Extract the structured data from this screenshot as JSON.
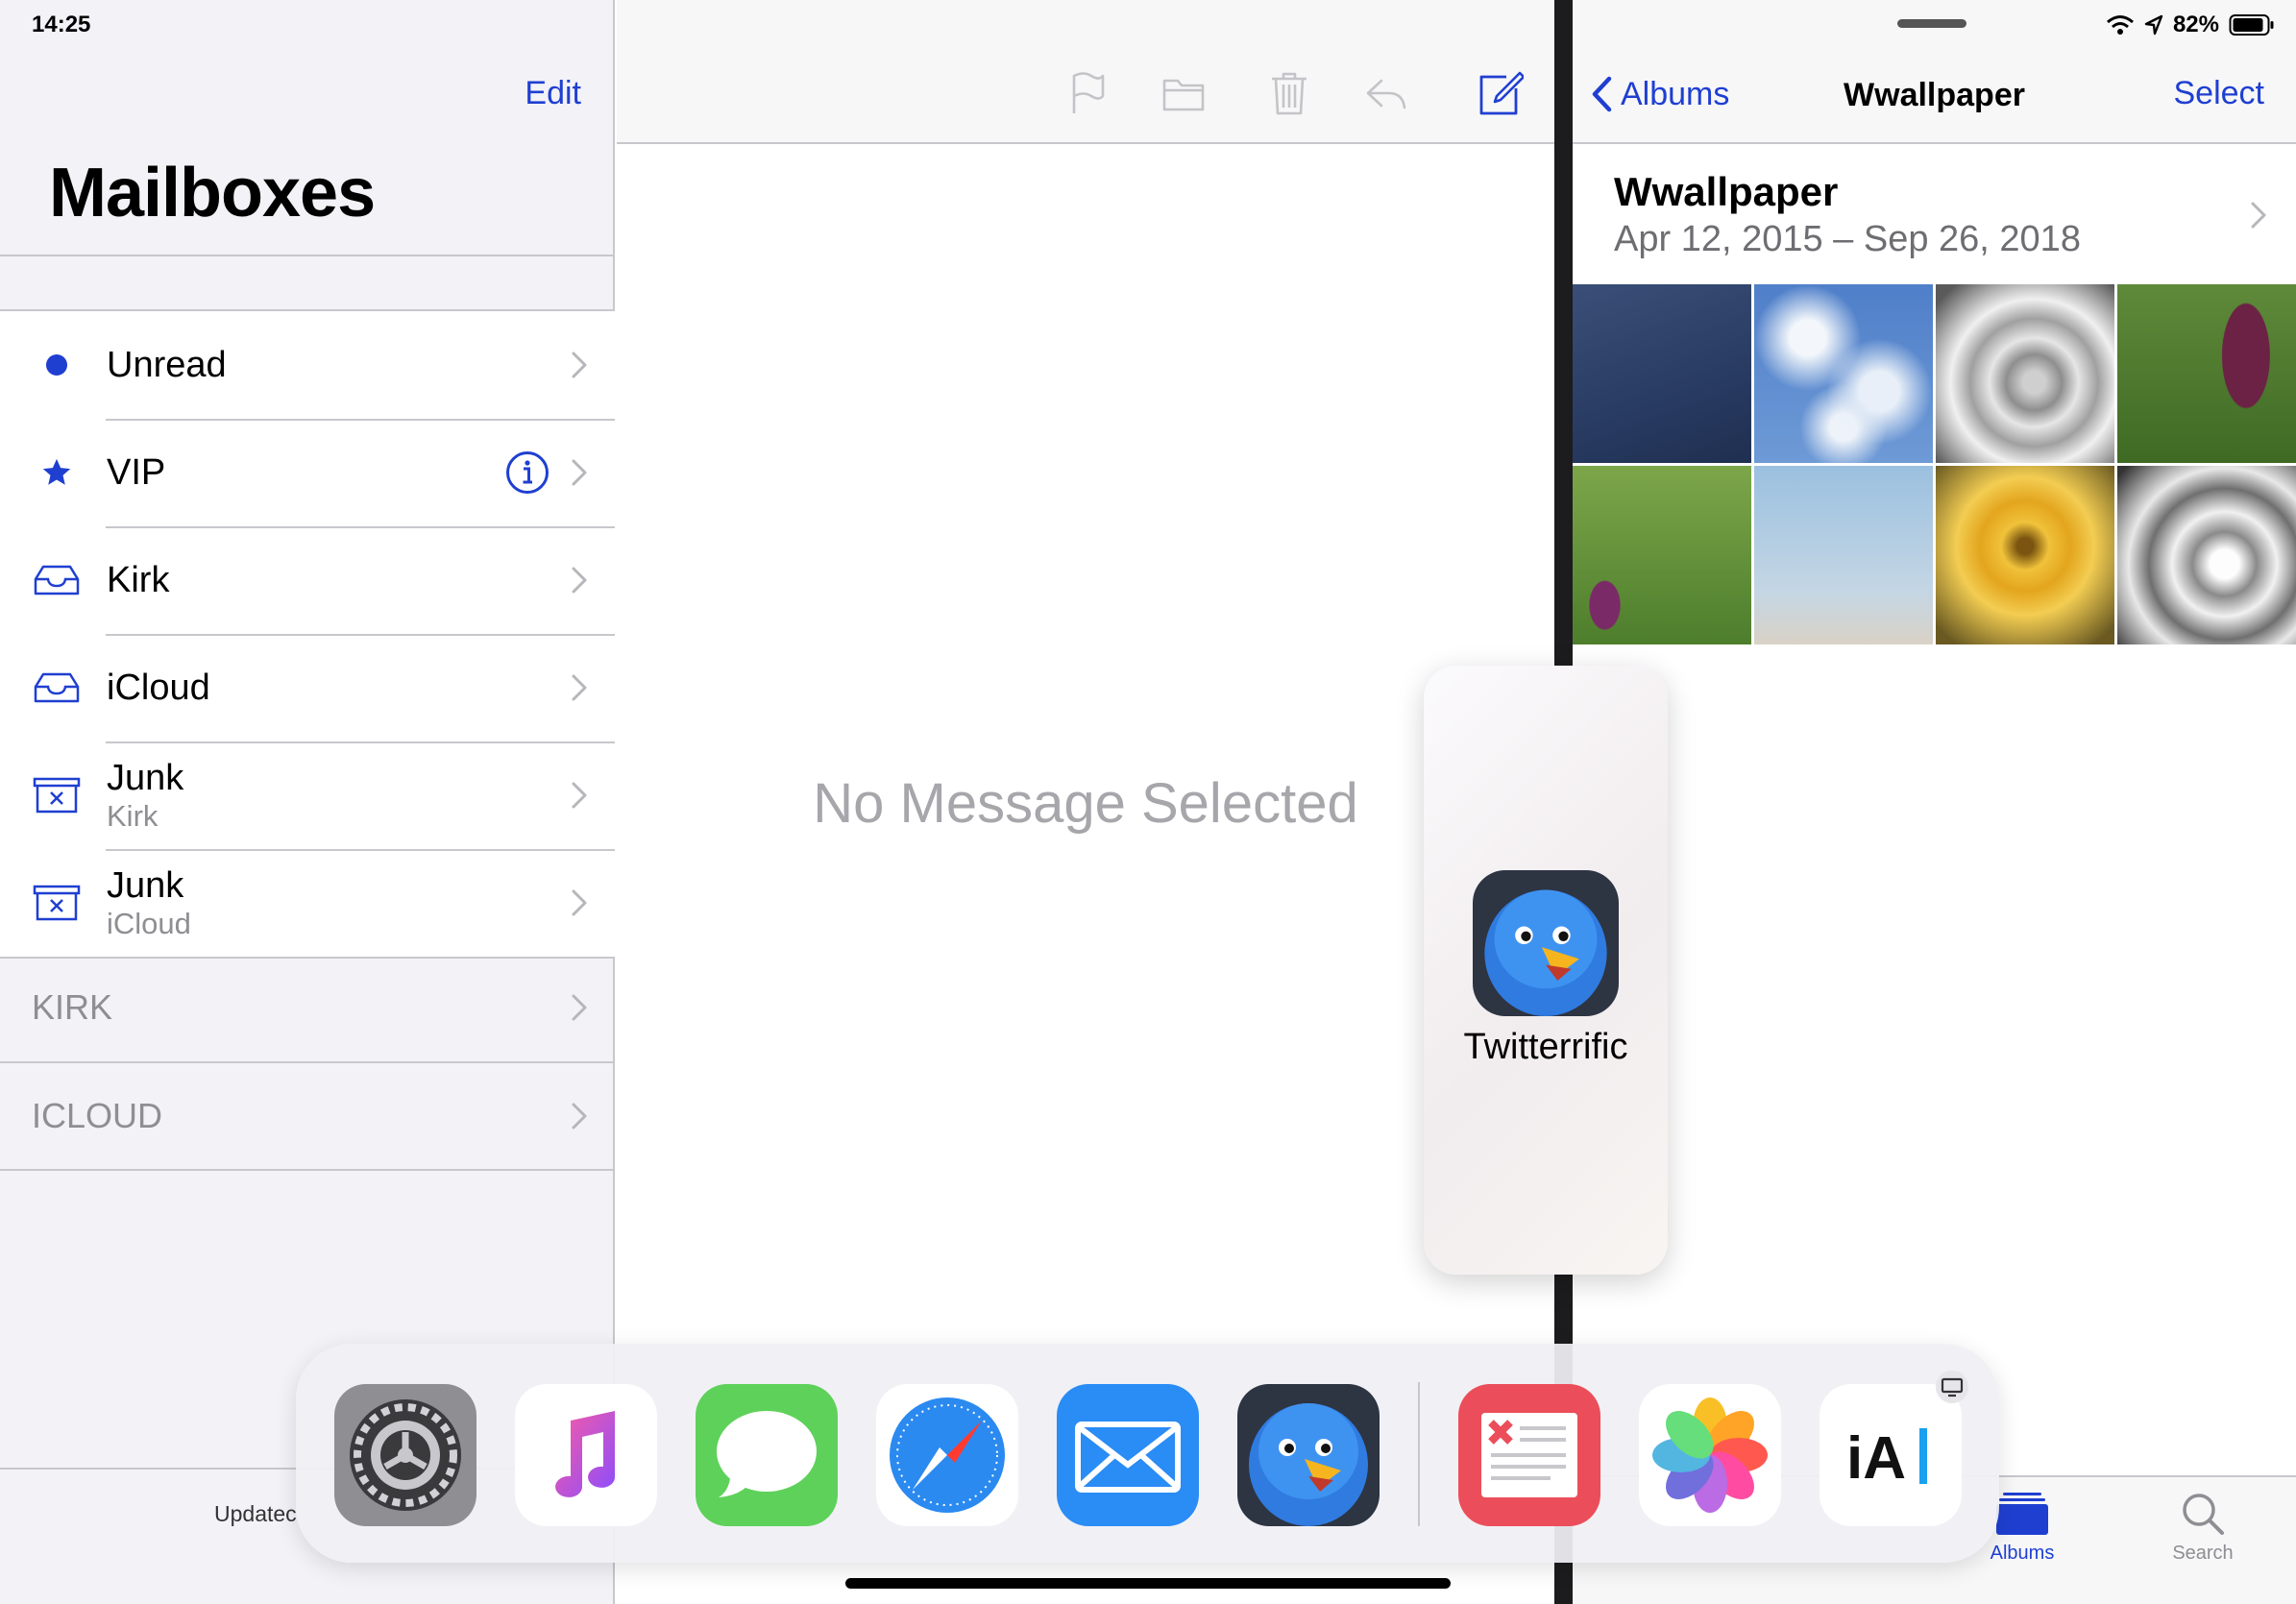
{
  "status": {
    "time": "14:25",
    "battery": "82%"
  },
  "mail": {
    "edit_label": "Edit",
    "title": "Mailboxes",
    "mailboxes": [
      {
        "label": "Unread",
        "sub": "",
        "icon": "unread-dot-icon"
      },
      {
        "label": "VIP",
        "sub": "",
        "icon": "star-icon"
      },
      {
        "label": "Kirk",
        "sub": "",
        "icon": "inbox-tray-icon"
      },
      {
        "label": "iCloud",
        "sub": "",
        "icon": "inbox-tray-icon"
      },
      {
        "label": "Junk",
        "sub": "Kirk",
        "icon": "junk-bin-icon"
      },
      {
        "label": "Junk",
        "sub": "iCloud",
        "icon": "junk-bin-icon"
      }
    ],
    "accounts": [
      "KIRK",
      "ICLOUD"
    ],
    "updated_text": "Updatec",
    "no_message": "No Message Selected",
    "toolbar_icons": [
      "flag-icon",
      "folder-icon",
      "trash-icon",
      "reply-icon",
      "compose-icon"
    ]
  },
  "photos": {
    "back_label": "Albums",
    "title": "Wwallpaper",
    "select_label": "Select",
    "album_name": "Wwallpaper",
    "album_range": "Apr 12, 2015 – Sep 26, 2018",
    "tabs": [
      {
        "label": "Albums",
        "icon": "albums-icon",
        "active": true
      },
      {
        "label": "Search",
        "icon": "search-icon",
        "active": false
      }
    ]
  },
  "slide_over": {
    "app_label": "Twitterrific"
  },
  "dock": {
    "apps": [
      "settings-app-icon",
      "music-app-icon",
      "messages-app-icon",
      "safari-app-icon",
      "mail-app-icon",
      "twitterrific-app-icon",
      "news-app-icon",
      "photos-app-icon",
      "ia-writer-app-icon"
    ],
    "ia_label": "iA"
  },
  "colors": {
    "accent": "#1f3fd1",
    "separator": "#c8c7cc",
    "secondary_text": "#8e8e93"
  }
}
